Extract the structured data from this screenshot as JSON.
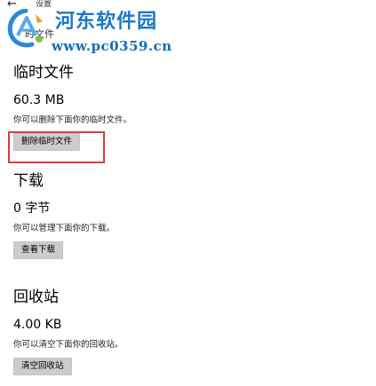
{
  "header": {
    "back_glyph": "←",
    "window_title": "设置",
    "page_subtitle": "时文件"
  },
  "watermark": {
    "site_name": "河东软件园",
    "site_url": "www.pc0359.cn",
    "brand_color": "#1a78c8"
  },
  "sections": [
    {
      "title": "临时文件",
      "size": "60.3 MB",
      "description": "你可以删除下面你的临时文件。",
      "button_label": "删除临时文件"
    },
    {
      "title": "下载",
      "size": "0 字节",
      "description": "你可以管理下面你的下载。",
      "button_label": "查看下载"
    },
    {
      "title": "回收站",
      "size": "4.00 KB",
      "description": "你可以清空下面你的回收站。",
      "button_label": "清空回收站"
    }
  ],
  "colors": {
    "highlight": "#e03a3a",
    "button_bg": "#cccccc"
  }
}
